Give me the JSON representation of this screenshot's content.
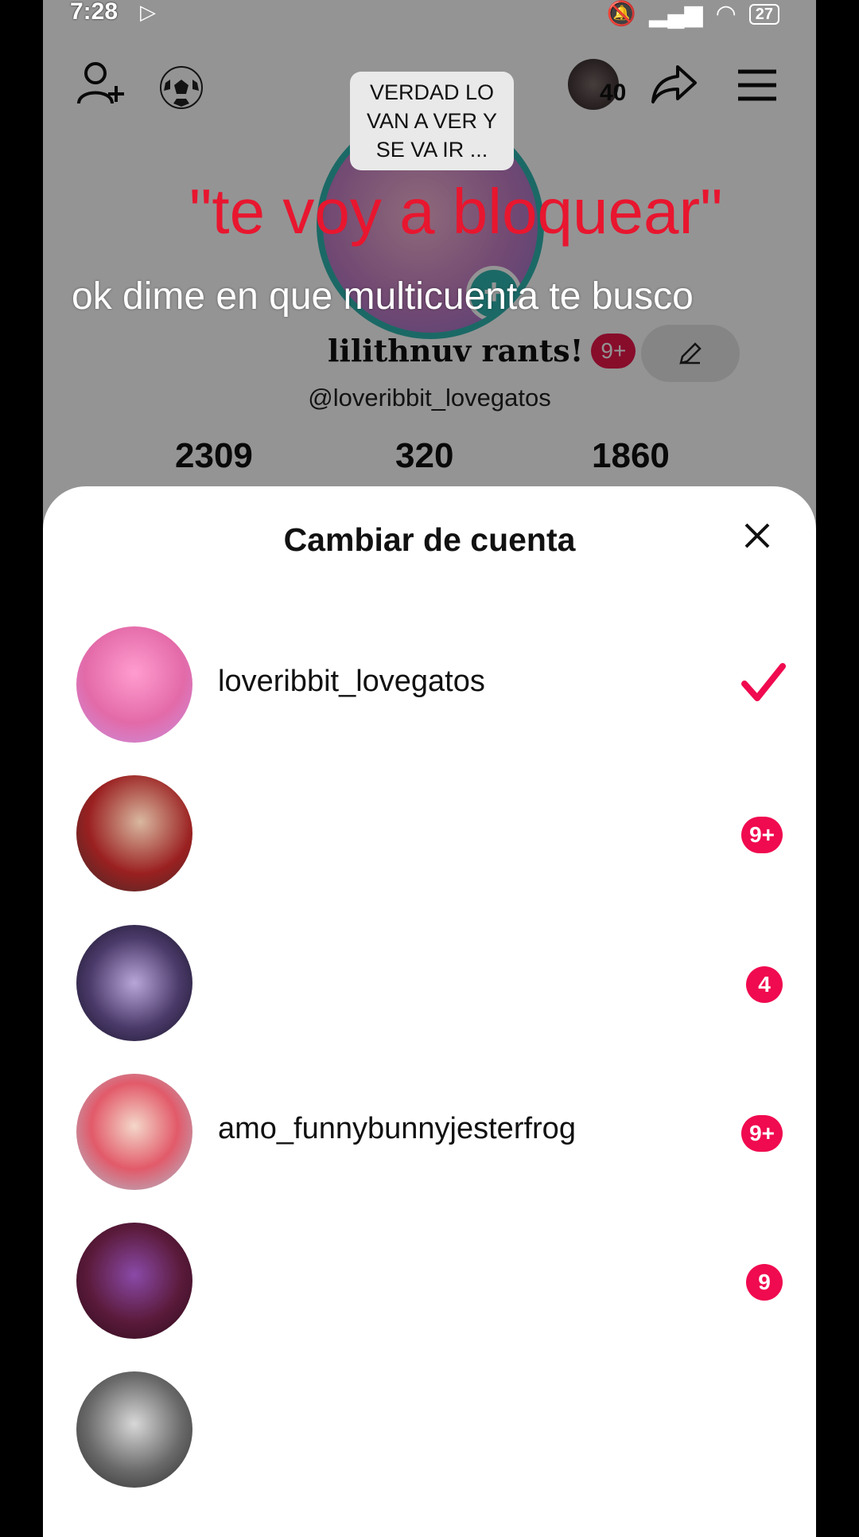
{
  "status_bar": {
    "time": "7:28",
    "battery": "27"
  },
  "profile": {
    "note": "VERDAD LO VAN A VER Y SE VA IR ...",
    "friends_count": "40",
    "display_name": "lilithnuv rants!",
    "name_badge": "9+",
    "handle": "@loveribbit_lovegatos",
    "stats": [
      {
        "value": "2309"
      },
      {
        "value": "320"
      },
      {
        "value": "1860"
      }
    ]
  },
  "overlay_text": {
    "red": "\"te voy a bloquear\"",
    "white": "ok dime en que multicuenta te busco"
  },
  "sheet": {
    "title": "Cambiar de cuenta",
    "accounts": [
      {
        "username": "loveribbit_lovegatos",
        "selected": true,
        "count": ""
      },
      {
        "username": "",
        "selected": false,
        "count": "9+"
      },
      {
        "username": "",
        "selected": false,
        "count": "4"
      },
      {
        "username": "amo_funnybunnyjesterfrog",
        "selected": false,
        "count": "9+"
      },
      {
        "username": "",
        "selected": false,
        "count": "9"
      },
      {
        "username": "",
        "selected": false,
        "count": ""
      }
    ]
  },
  "colors": {
    "accent": "#f00a4f",
    "overlay_red": "#e8162f",
    "avatar_ring": "#2fb5b0"
  },
  "icons": [
    "add-friend-icon",
    "soccer-ball-icon",
    "share-icon",
    "menu-icon",
    "edit-pencil-icon",
    "close-icon",
    "checkmark-icon",
    "play-store-icon"
  ]
}
